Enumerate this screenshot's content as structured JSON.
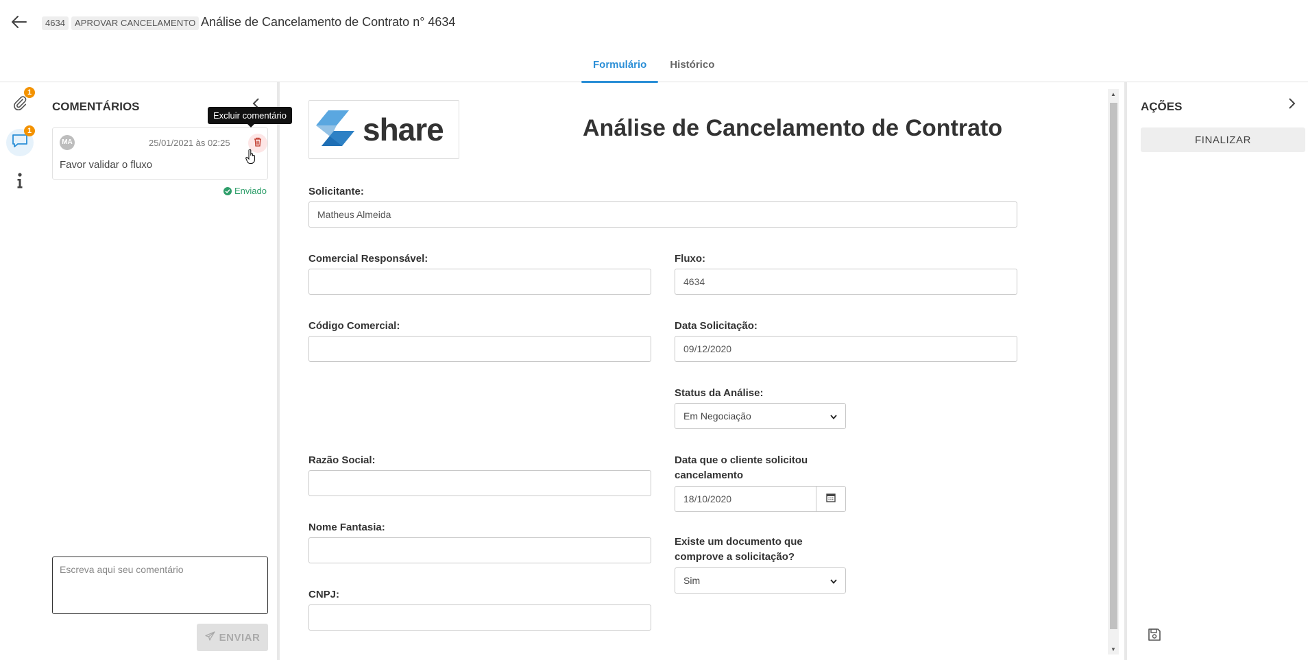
{
  "header": {
    "process_id": "4634",
    "stage": "APROVAR CANCELAMENTO",
    "title": "Análise de Cancelamento de Contrato n° 4634",
    "tabs": [
      {
        "label": "Formulário",
        "active": true
      },
      {
        "label": "Histórico",
        "active": false
      }
    ]
  },
  "rail": {
    "attachments_badge": "1",
    "comments_badge": "1",
    "icons": [
      "paperclip-icon",
      "comment-icon",
      "info-icon"
    ]
  },
  "comments_panel": {
    "title": "COMENTÁRIOS",
    "comment": {
      "avatar_initials": "MA",
      "datetime": "25/01/2021 às 02:25",
      "text": "Favor validar o fluxo",
      "status": "Enviado"
    },
    "tooltip": "Excluir comentário",
    "input_placeholder": "Escreva aqui seu comentário",
    "send_label": "ENVIAR"
  },
  "form": {
    "logo_text": "share",
    "title": "Análise de Cancelamento de Contrato",
    "fields": {
      "solicitante": {
        "label": "Solicitante:",
        "value": "Matheus Almeida"
      },
      "comercial": {
        "label": "Comercial Responsável:",
        "value": ""
      },
      "fluxo": {
        "label": "Fluxo:",
        "value": "4634"
      },
      "codigo": {
        "label": "Código Comercial:",
        "value": ""
      },
      "data_solicitacao": {
        "label": "Data Solicitação:",
        "value": "09/12/2020"
      },
      "status": {
        "label": "Status da Análise:",
        "value": "Em Negociação"
      },
      "razao": {
        "label": "Razão Social:",
        "value": ""
      },
      "data_cliente": {
        "label_line1": "Data que o cliente solicitou",
        "label_line2": "cancelamento",
        "value": "18/10/2020"
      },
      "fantasia": {
        "label": "Nome Fantasia:",
        "value": ""
      },
      "documento": {
        "label_line1": "Existe um documento que",
        "label_line2": "comprove a solicitação?",
        "value": "Sim"
      },
      "cnpj": {
        "label": "CNPJ:",
        "value": ""
      }
    }
  },
  "actions_panel": {
    "title": "AÇÕES",
    "finalize_label": "FINALIZAR"
  },
  "colors": {
    "accent": "#2a8ed6",
    "badge": "#f39200",
    "success": "#2e9e6a"
  }
}
